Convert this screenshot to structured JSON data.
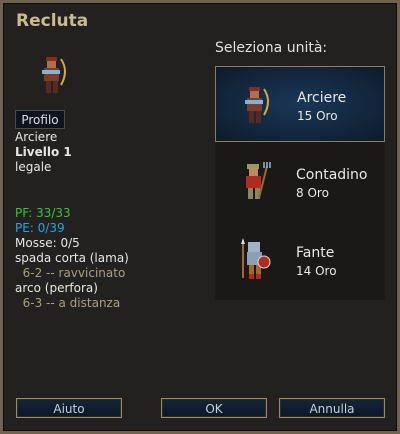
{
  "title": "Recluta",
  "details": {
    "profile_button": "Profilo",
    "unit_type": "Arciere",
    "level": "Livello 1",
    "alignment": "legale",
    "hp": "PF: 33/33",
    "xp": "PE: 0/39",
    "moves": "Mosse: 0/5",
    "attacks": [
      {
        "name": "spada corta (lama)",
        "stats": "  6-2 -- ravvicinato"
      },
      {
        "name": "arco (perfora)",
        "stats": "  6-3 -- a distanza"
      }
    ],
    "colors": {
      "hp": "#3bc43b",
      "xp": "#2aa3e0"
    }
  },
  "list": {
    "label": "Seleziona unità:",
    "units": [
      {
        "name": "Arciere",
        "cost": "15 Oro",
        "selected": true
      },
      {
        "name": "Contadino",
        "cost": "8 Oro",
        "selected": false
      },
      {
        "name": "Fante",
        "cost": "14 Oro",
        "selected": false
      }
    ]
  },
  "buttons": {
    "help": "Aiuto",
    "ok": "OK",
    "cancel": "Annulla"
  }
}
